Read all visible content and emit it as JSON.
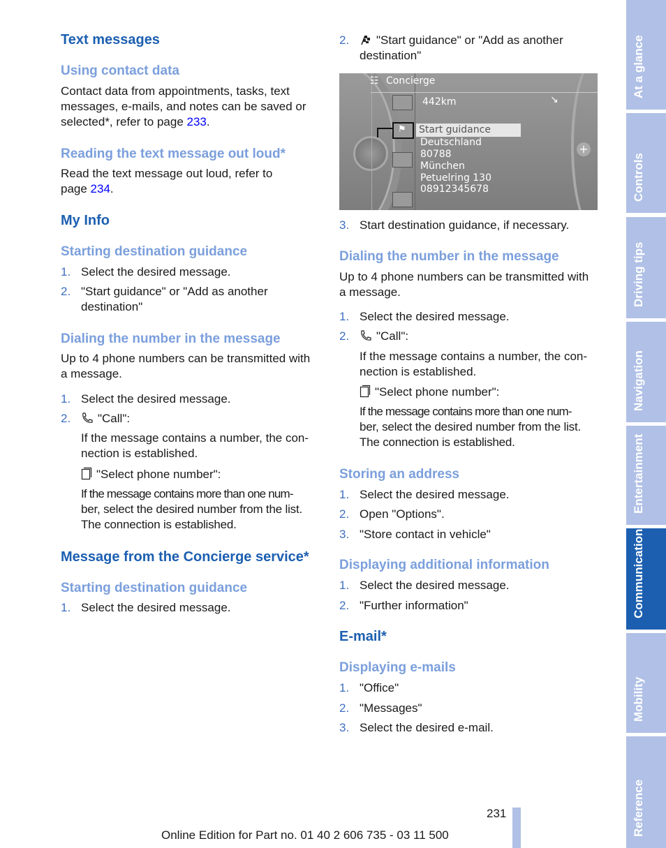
{
  "left": {
    "h_text_messages": "Text messages",
    "h_using_contact": "Using contact data",
    "contact_lines": [
      "Contact data from appointments, tasks, text",
      "messages, e-mails, and notes can be saved or",
      "selected*, refer to page "
    ],
    "contact_link": "233",
    "h_reading": "Reading the text message out loud*",
    "reading_lines": [
      "Read the text message out loud, refer to",
      "page "
    ],
    "reading_link": "234",
    "h_my_info": "My Info",
    "h_start_guid": "Starting destination guidance",
    "guid_steps": [
      {
        "n": "1.",
        "t": "Select the desired message."
      },
      {
        "n": "2.",
        "t": "\"Start guidance\" or \"Add as another",
        "t2": "destination\""
      }
    ],
    "h_dialing": "Dialing the number in the message",
    "dial_para": [
      "Up to 4 phone numbers can be transmitted with",
      "a message."
    ],
    "dial_steps": [
      {
        "n": "1.",
        "t": "Select the desired message."
      },
      {
        "n": "2.",
        "t": "\"Call\":"
      }
    ],
    "dial_note": [
      "If the message contains a number, the con-",
      "nection is established."
    ],
    "select_phone": "\"Select phone number\":",
    "select_note": [
      "If the message contains more than one num-",
      "ber, select the desired number from the list.",
      "The connection is established."
    ],
    "h_concierge": "Message from the Concierge service*",
    "h_start_guid2": "Starting destination guidance",
    "guid2_steps": [
      {
        "n": "1.",
        "t": "Select the desired message."
      }
    ]
  },
  "right": {
    "guid_step2": {
      "n": "2.",
      "t": "\"Start guidance\" or \"Add as another",
      "t2": "destination\""
    },
    "screen": {
      "title": "Concierge",
      "distance": "442km",
      "selected": "Start guidance",
      "lines": [
        "Deutschland",
        "80788",
        "München",
        "Petuelring 130",
        "08912345678"
      ]
    },
    "guid_step3": {
      "n": "3.",
      "t": "Start destination guidance, if necessary."
    },
    "h_dialing": "Dialing the number in the message",
    "dial_para": [
      "Up to 4 phone numbers can be transmitted with",
      "a message."
    ],
    "dial_steps": [
      {
        "n": "1.",
        "t": "Select the desired message."
      },
      {
        "n": "2.",
        "t": "\"Call\":"
      }
    ],
    "dial_note": [
      "If the message contains a number, the con-",
      "nection is established."
    ],
    "select_phone": "\"Select phone number\":",
    "select_note": [
      "If the message contains more than one num-",
      "ber, select the desired number from the list.",
      "The connection is established."
    ],
    "h_storing": "Storing an address",
    "store_steps": [
      {
        "n": "1.",
        "t": "Select the desired message."
      },
      {
        "n": "2.",
        "t": "Open \"Options\"."
      },
      {
        "n": "3.",
        "t": "\"Store contact in vehicle\""
      }
    ],
    "h_additional": "Displaying additional information",
    "add_steps": [
      {
        "n": "1.",
        "t": "Select the desired message."
      },
      {
        "n": "2.",
        "t": "\"Further information\""
      }
    ],
    "h_email": "E-mail*",
    "h_disp_email": "Displaying e-mails",
    "email_steps": [
      {
        "n": "1.",
        "t": "\"Office\""
      },
      {
        "n": "2.",
        "t": "\"Messages\""
      },
      {
        "n": "3.",
        "t": "Select the desired e-mail."
      }
    ]
  },
  "sidebar": {
    "tabs": [
      "At a glance",
      "Controls",
      "Driving tips",
      "Navigation",
      "Entertainment",
      "Communication",
      "Mobility",
      "Reference"
    ],
    "active": "Communication"
  },
  "footer": {
    "page_number": "231",
    "edition": "Online Edition for Part no. 01 40 2 606 735 - 03 11 500"
  },
  "colors": {
    "heading": "#1c5fb0",
    "subheading": "#7b9fdc",
    "link": "#0000ff",
    "tab": "#b0c0e6",
    "tab_active": "#1c5fb0"
  }
}
